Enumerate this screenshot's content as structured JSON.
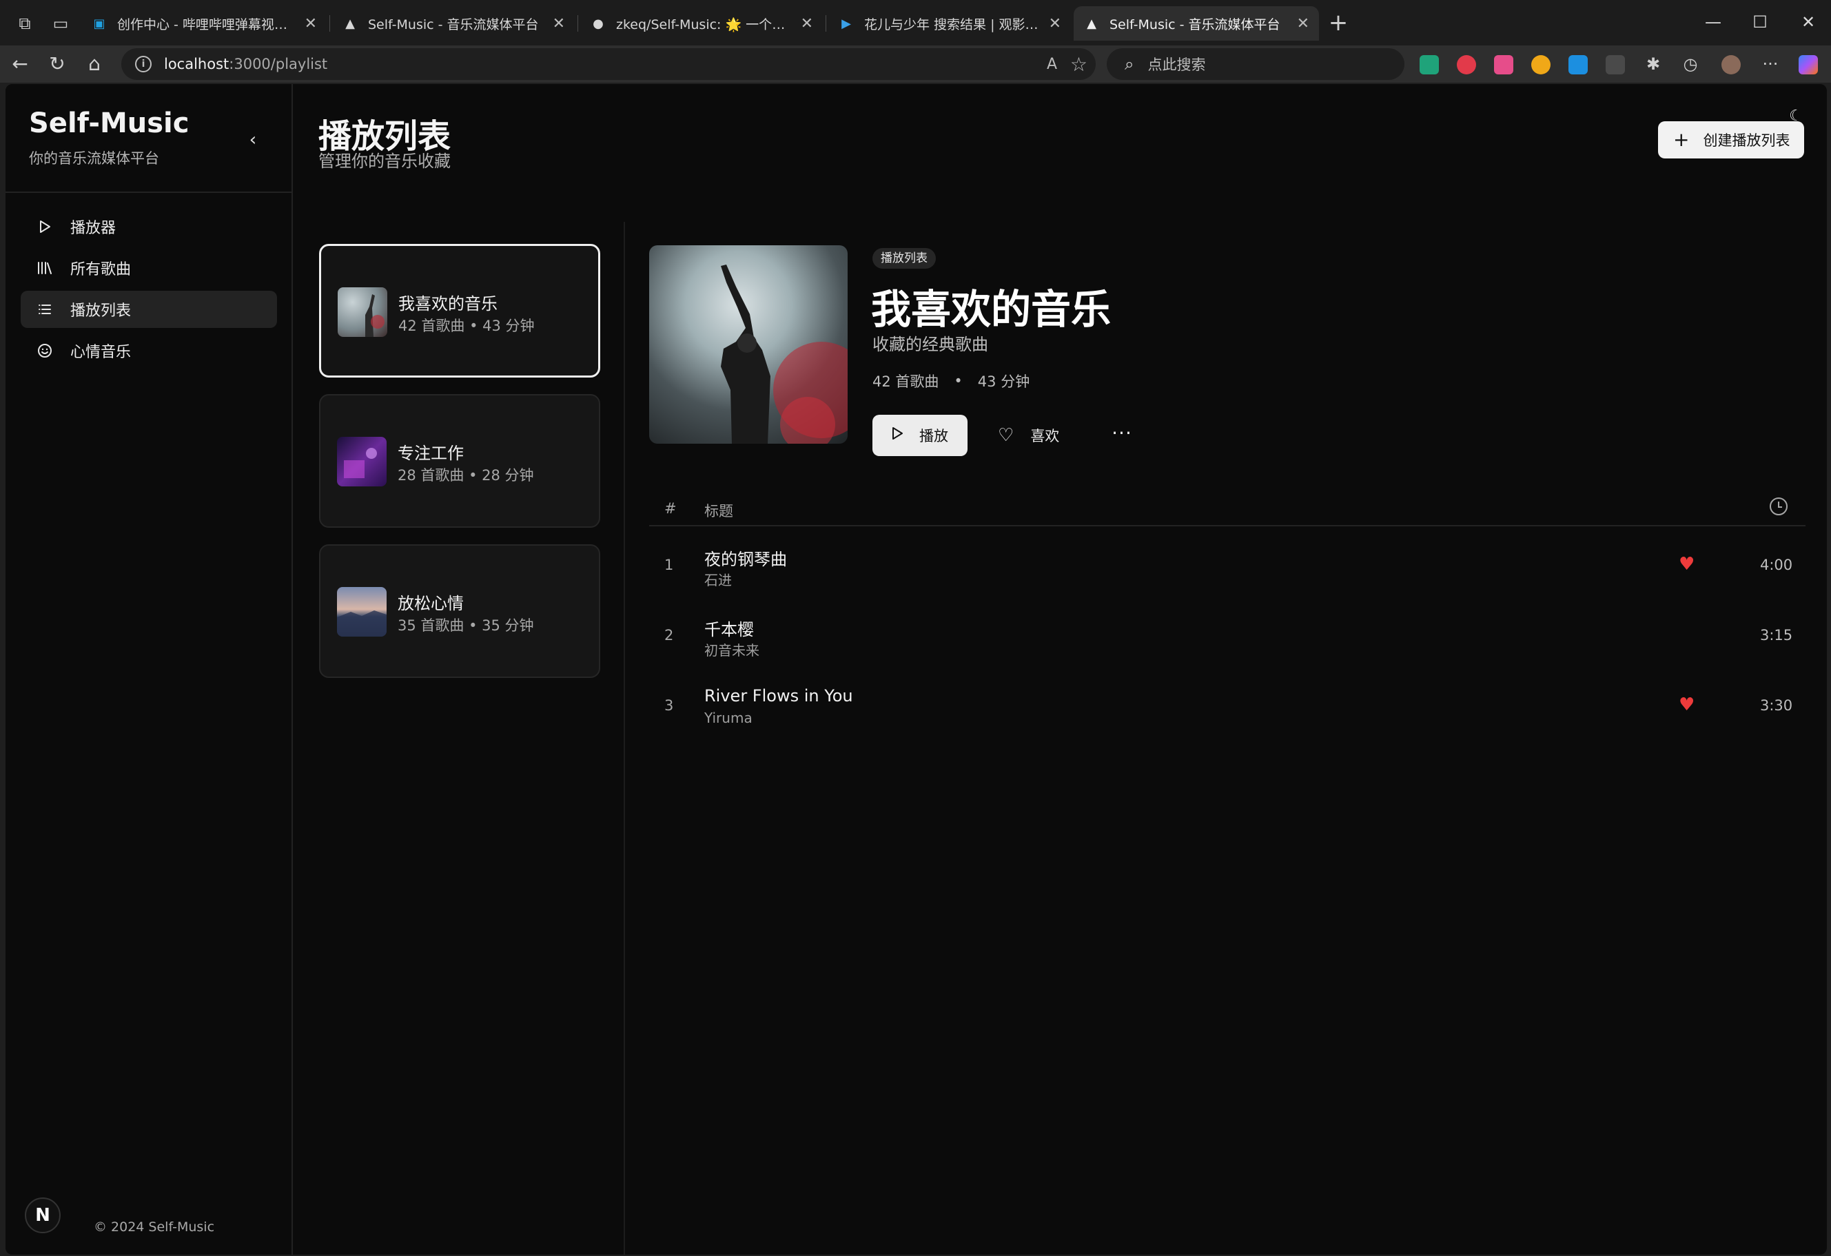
{
  "browser": {
    "tabs": [
      {
        "title": "创作中心 - 哔哩哔哩弹幕视频网",
        "icon": "bilibili-icon",
        "active": false
      },
      {
        "title": "Self-Music - 音乐流媒体平台",
        "icon": "triangle-icon",
        "active": false
      },
      {
        "title": "zkeq/Self-Music: 🌟 一个现代化音",
        "icon": "github-icon",
        "active": false
      },
      {
        "title": "花儿与少年 搜索结果 | 观影 GYING",
        "icon": "play-icon",
        "active": false
      },
      {
        "title": "Self-Music - 音乐流媒体平台",
        "icon": "triangle-icon",
        "active": true
      }
    ],
    "url_host": "localhost",
    "url_path": ":3000/playlist",
    "search_placeholder": "点此搜索"
  },
  "sidebar": {
    "brand": "Self-Music",
    "brand_sub": "你的音乐流媒体平台",
    "nav": [
      {
        "label": "播放器",
        "icon": "play-icon",
        "active": false
      },
      {
        "label": "所有歌曲",
        "icon": "library-icon",
        "active": false
      },
      {
        "label": "播放列表",
        "icon": "list-icon",
        "active": true
      },
      {
        "label": "心情音乐",
        "icon": "smile-icon",
        "active": false
      }
    ],
    "badge": "N",
    "copyright": "© 2024 Self-Music"
  },
  "header": {
    "title": "播放列表",
    "subtitle": "管理你的音乐收藏",
    "create_label": "创建播放列表"
  },
  "playlists": [
    {
      "name": "我喜欢的音乐",
      "meta": "42 首歌曲 • 43 分钟",
      "selected": true
    },
    {
      "name": "专注工作",
      "meta": "28 首歌曲 • 28 分钟",
      "selected": false
    },
    {
      "name": "放松心情",
      "meta": "35 首歌曲 • 35 分钟",
      "selected": false
    }
  ],
  "detail": {
    "tag": "播放列表",
    "title": "我喜欢的音乐",
    "description": "收藏的经典歌曲",
    "song_count": "42 首歌曲",
    "dot": "•",
    "duration": "43 分钟",
    "play_label": "播放",
    "like_label": "喜欢",
    "more_label": "···"
  },
  "table": {
    "col_num": "#",
    "col_title": "标题",
    "rows": [
      {
        "num": "1",
        "title": "夜的钢琴曲",
        "artist": "石进",
        "liked": true,
        "duration": "4:00"
      },
      {
        "num": "2",
        "title": "千本樱",
        "artist": "初音未来",
        "liked": false,
        "duration": "3:15"
      },
      {
        "num": "3",
        "title": "River Flows in You",
        "artist": "Yiruma",
        "liked": true,
        "duration": "3:30"
      }
    ]
  },
  "colors": {
    "background": "#0b0b0b",
    "heart": "#ee3b3b",
    "button_light": "#ececec"
  }
}
